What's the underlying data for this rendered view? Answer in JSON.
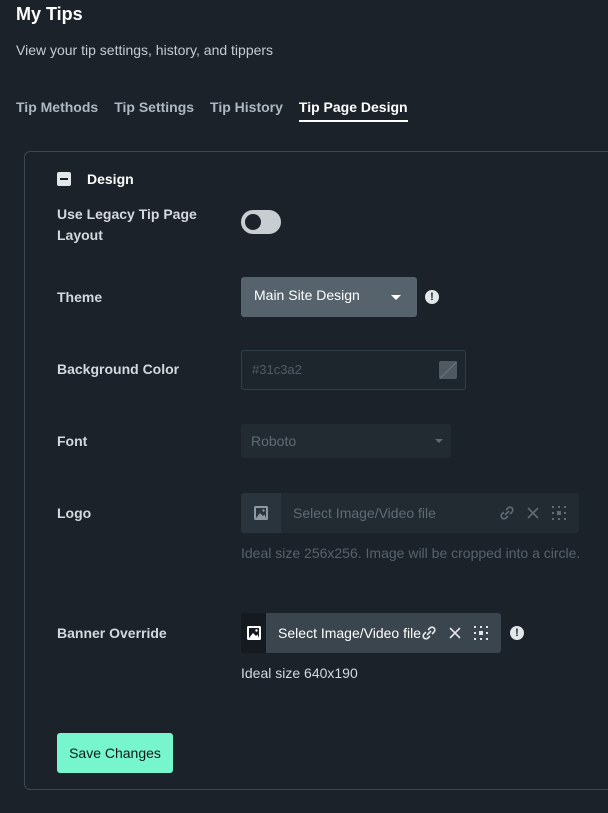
{
  "page": {
    "title": "My Tips",
    "subtitle": "View your tip settings, history, and tippers"
  },
  "tabs": [
    {
      "label": "Tip Methods",
      "active": false
    },
    {
      "label": "Tip Settings",
      "active": false
    },
    {
      "label": "Tip History",
      "active": false
    },
    {
      "label": "Tip Page Design",
      "active": true
    }
  ],
  "design": {
    "section_label": "Design",
    "legacy_layout": {
      "label": "Use Legacy Tip Page Layout",
      "enabled": false
    },
    "theme": {
      "label": "Theme",
      "value": "Main Site Design"
    },
    "background_color": {
      "label": "Background Color",
      "placeholder": "#31c3a2"
    },
    "font": {
      "label": "Font",
      "value": "Roboto"
    },
    "logo": {
      "label": "Logo",
      "placeholder": "Select Image/Video file",
      "hint": "Ideal size 256x256. Image will be cropped into a circle."
    },
    "banner": {
      "label": "Banner Override",
      "value": "Select Image/Video file",
      "hint": "Ideal size 640x190"
    },
    "save_label": "Save Changes"
  },
  "colors": {
    "background": "#1b2229",
    "accent": "#77f5cc",
    "select_bg": "#56636d"
  }
}
